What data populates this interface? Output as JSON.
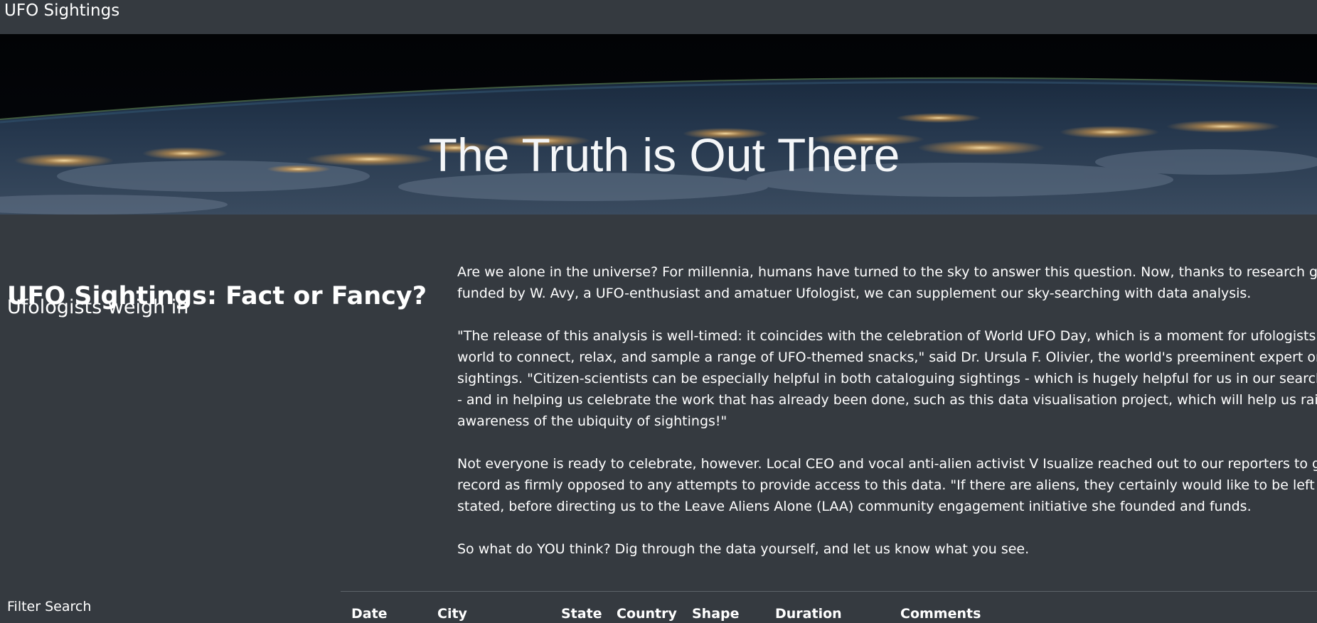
{
  "navbar": {
    "brand": "UFO Sightings"
  },
  "hero": {
    "title": "The Truth is Out There"
  },
  "sidebar": {
    "heading": "UFO Sightings: Fact or Fancy?",
    "subheading": "Ufologists weigh in",
    "filter_label": "Filter Search"
  },
  "article": {
    "p1": [
      "Are we alone in the universe? For millennia, humans have turned to the sky to answer this question. Now, thanks to research generously",
      "funded by W. Avy, a UFO-enthusiast and amatuer Ufologist, we can supplement our sky-searching with data analysis."
    ],
    "p2": [
      "\"The release of this analysis is well-timed: it coincides with the celebration of World UFO Day, which is a moment for ufologists around the",
      "world to connect, relax, and sample a range of UFO-themed snacks,\" said Dr. Ursula F. Olivier, the world's preeminent expert on circular",
      "sightings. \"Citizen-scientists can be especially helpful in both cataloguing sightings - which is hugely helpful for us in our search for aliens",
      "- and in helping us celebrate the work that has already been done, such as this data visualisation project, which will help us raise",
      "awareness of the ubiquity of sightings!\""
    ],
    "p3": [
      "Not everyone is ready to celebrate, however. Local CEO and vocal anti-alien activist V Isualize reached out to our reporters to go on",
      "record as firmly opposed to any attempts to provide access to this data. \"If there are aliens, they certainly would like to be left alone,\" she",
      "stated, before directing us to the Leave Aliens Alone (LAA) community engagement initiative she founded and funds."
    ],
    "p4": [
      "So what do YOU think? Dig through the data yourself, and let us know what you see."
    ]
  },
  "table": {
    "columns": [
      "Date",
      "City",
      "State",
      "Country",
      "Shape",
      "Duration",
      "Comments"
    ]
  }
}
